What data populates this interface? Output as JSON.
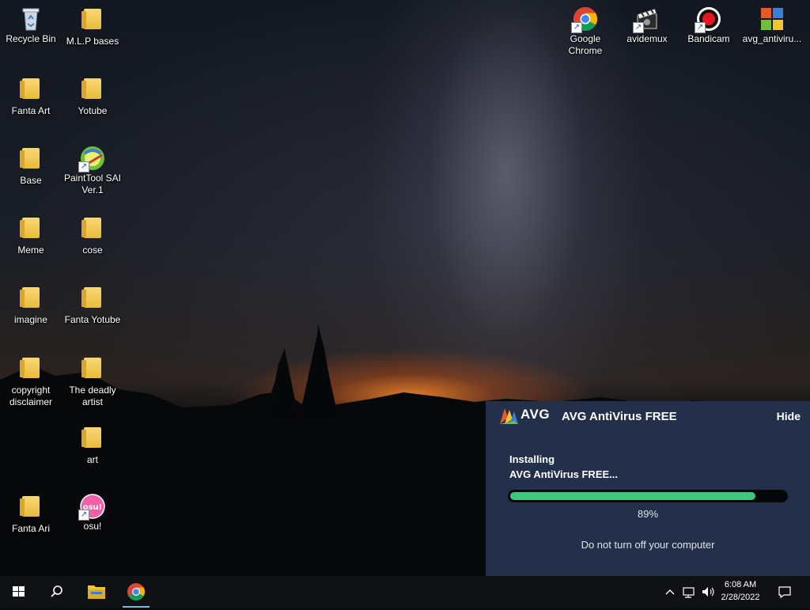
{
  "desktop": {
    "icons": [
      {
        "name": "recycle-bin",
        "label": "Recycle Bin",
        "kind": "recycle-bin-icon"
      },
      {
        "name": "folder-mlp-bases",
        "label": "M.L.P bases",
        "kind": "folder-icon"
      },
      {
        "name": "folder-fanta-art",
        "label": "Fanta Art",
        "kind": "folder-icon"
      },
      {
        "name": "folder-yotube",
        "label": "Yotube",
        "kind": "folder-icon"
      },
      {
        "name": "folder-base",
        "label": "Base",
        "kind": "folder-icon"
      },
      {
        "name": "painttool-sai",
        "label": "PaintTool SAI\nVer.1",
        "kind": "painttool-sai-icon"
      },
      {
        "name": "folder-meme",
        "label": "Meme",
        "kind": "folder-icon"
      },
      {
        "name": "folder-cose",
        "label": "cose",
        "kind": "folder-icon"
      },
      {
        "name": "folder-imagine",
        "label": "imagine",
        "kind": "folder-icon"
      },
      {
        "name": "folder-fanta-yotube",
        "label": "Fanta Yotube",
        "kind": "folder-icon"
      },
      {
        "name": "folder-copyright-disclaimer",
        "label": "copyright\ndisclaimer",
        "kind": "folder-icon"
      },
      {
        "name": "folder-the-deadly-artist",
        "label": "The deadly\nartist",
        "kind": "folder-icon"
      },
      {
        "name": "folder-art",
        "label": "art",
        "kind": "folder-icon"
      },
      {
        "name": "folder-fanta-ari",
        "label": "Fanta Ari",
        "kind": "folder-icon"
      },
      {
        "name": "osu",
        "label": "osu!",
        "kind": "osu-icon"
      },
      {
        "name": "google-chrome",
        "label": "Google\nChrome",
        "kind": "chrome-icon"
      },
      {
        "name": "avidemux",
        "label": "avidemux",
        "kind": "avidemux-icon"
      },
      {
        "name": "bandicam",
        "label": "Bandicam",
        "kind": "bandicam-icon"
      },
      {
        "name": "avg-antivirus",
        "label": "avg_antiviru...",
        "kind": "avg-icon"
      }
    ]
  },
  "avg_popup": {
    "brand": "AVG",
    "title": "AVG AntiVirus FREE",
    "hide_label": "Hide",
    "status_line1": "Installing",
    "status_line2": "AVG AntiVirus FREE...",
    "progress_percent": 89,
    "progress_text": "89%",
    "notice": "Do not turn off your computer",
    "colors": {
      "background": "#243049",
      "progress": "#3ec87f",
      "track": "#05070a"
    }
  },
  "taskbar": {
    "start_icon": "windows-start-icon",
    "search_icon": "search-icon",
    "pinned": [
      {
        "name": "file-explorer",
        "icon": "folder-icon",
        "active": false
      },
      {
        "name": "google-chrome",
        "icon": "chrome-icon",
        "active": true
      }
    ],
    "tray": {
      "icons": [
        "chevron-up-icon",
        "network-icon",
        "volume-icon"
      ],
      "time": "6:08 AM",
      "date": "2/28/2022",
      "notifications_icon": "action-center-icon"
    }
  }
}
